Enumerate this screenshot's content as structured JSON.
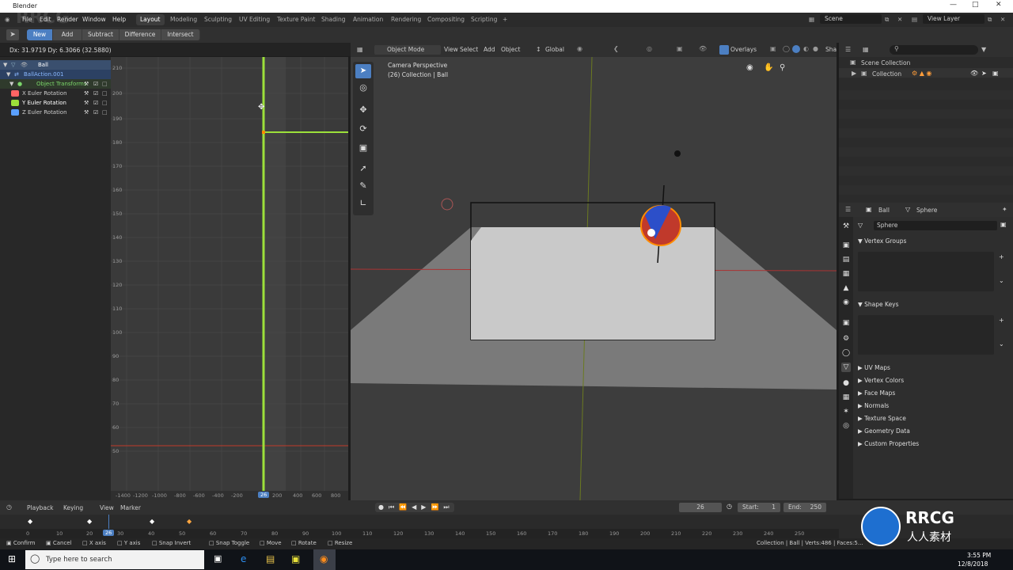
{
  "window": {
    "title": "Blender"
  },
  "menu": [
    "File",
    "Edit",
    "Render",
    "Window",
    "Help"
  ],
  "workspaces": [
    {
      "label": "Layout",
      "active": true
    },
    {
      "label": "Modeling"
    },
    {
      "label": "Sculpting"
    },
    {
      "label": "UV Editing"
    },
    {
      "label": "Texture Paint"
    },
    {
      "label": "Shading"
    },
    {
      "label": "Animation"
    },
    {
      "label": "Rendering"
    },
    {
      "label": "Compositing"
    },
    {
      "label": "Scripting"
    }
  ],
  "add_workspace": "+",
  "scene": {
    "label": "Scene",
    "view_layer": "View Layer"
  },
  "tool_header": {
    "new": "New",
    "add": "Add",
    "subtract": "Subtract",
    "difference": "Difference",
    "intersect": "Intersect"
  },
  "graph_status": "Dx: 31.9719  Dy: 6.3066 (32.5880)",
  "channels": [
    {
      "label": "Ball",
      "color": "#ffffff"
    },
    {
      "label": "BallAction.001",
      "color": "#8ab8ff"
    },
    {
      "label": "Object Transforms",
      "color": "#7bd66a"
    },
    {
      "label": "X Euler Rotation",
      "color": "#ff6464"
    },
    {
      "label": "Y Euler Rotation",
      "color": "#b8ff5a"
    },
    {
      "label": "Z Euler Rotation",
      "color": "#5aa0ff"
    }
  ],
  "graph": {
    "y_ticks": [
      "210",
      "200",
      "190",
      "180",
      "170",
      "160",
      "150",
      "140",
      "130",
      "120",
      "110",
      "100",
      "90",
      "80",
      "70",
      "60",
      "50"
    ],
    "x_ticks": [
      "-1400",
      "-1200",
      "-1000",
      "-800",
      "-600",
      "-400",
      "-200",
      "26",
      "200",
      "400",
      "600",
      "800"
    ],
    "current_frame": "26"
  },
  "viewport_header": {
    "mode": "Object Mode",
    "menus": [
      "View",
      "Select",
      "Add",
      "Object"
    ],
    "orientation": "Global",
    "overlays": "Overlays",
    "shading": "Sha"
  },
  "viewport_overlay": {
    "line1": "Camera Perspective",
    "line2": "(26) Collection | Ball"
  },
  "outliner": {
    "scene_collection": "Scene Collection",
    "collection": "Collection"
  },
  "properties": {
    "object": "Ball",
    "data": "Sphere",
    "mesh_name": "Sphere",
    "panels": [
      "Vertex Groups",
      "Shape Keys",
      "UV Maps",
      "Vertex Colors",
      "Face Maps",
      "Normals",
      "Texture Space",
      "Geometry Data",
      "Custom Properties"
    ]
  },
  "timeline_header": {
    "menus": [
      "Playback",
      "Keying",
      "View",
      "Marker"
    ],
    "current": "26",
    "start_label": "Start:",
    "start": "1",
    "end_label": "End:",
    "end": "250"
  },
  "timeline_ticks": [
    "0",
    "10",
    "20",
    "30",
    "40",
    "50",
    "60",
    "70",
    "80",
    "90",
    "100",
    "110",
    "120",
    "130",
    "140",
    "150",
    "160",
    "170",
    "180",
    "190",
    "200",
    "210",
    "220",
    "230",
    "240",
    "250"
  ],
  "status": {
    "items": [
      "Confirm",
      "Cancel",
      "X axis",
      "Y axis",
      "Snap Invert",
      "Snap Toggle",
      "Move",
      "Rotate",
      "Resize"
    ],
    "stats": "Collection | Ball | Verts:486 | Faces:5..."
  },
  "taskbar": {
    "search_placeholder": "Type here to search",
    "time": "3:55 PM",
    "date": "12/8/2018"
  },
  "watermarks": [
    "RRCG",
    "人人素材"
  ]
}
